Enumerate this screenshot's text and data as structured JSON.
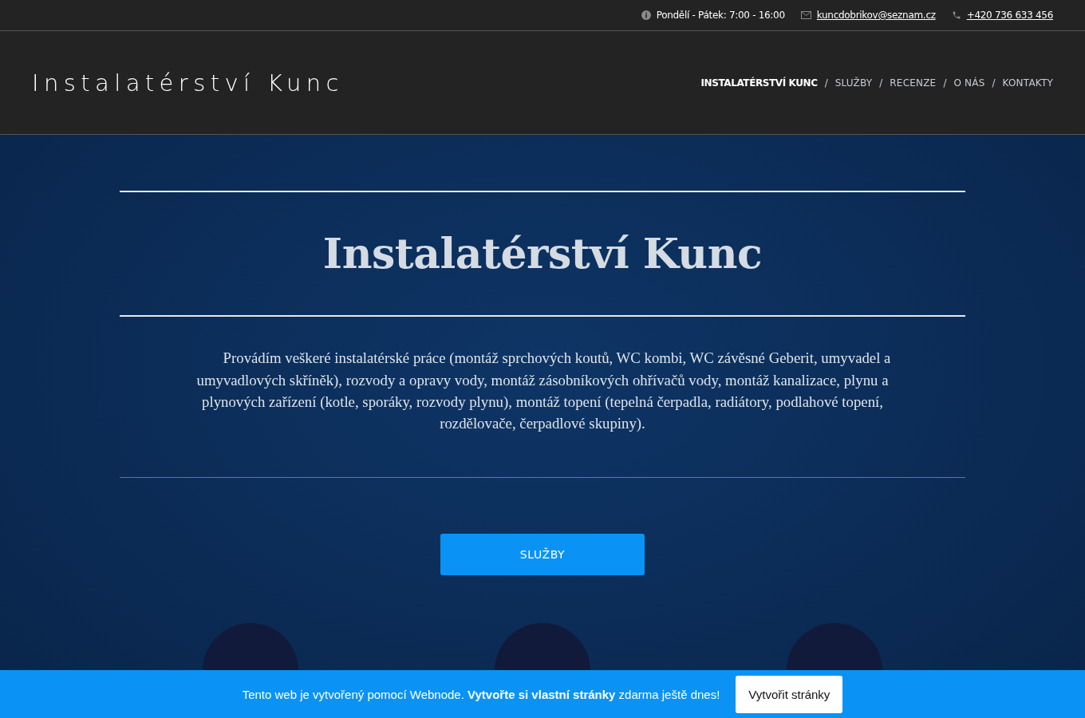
{
  "top_bar": {
    "hours": "Pondělí - Pátek: 7:00 - 16:00",
    "email": "kuncdobrikov@seznam.cz",
    "phone": "+420 736 633 456"
  },
  "header": {
    "logo": "Instalatérství Kunc",
    "nav_separator": "/",
    "nav": [
      {
        "label": "INSTALATÉRSTVÍ KUNC",
        "selected": true
      },
      {
        "label": "SLUŽBY",
        "selected": false
      },
      {
        "label": "RECENZE",
        "selected": false
      },
      {
        "label": "O NÁS",
        "selected": false
      },
      {
        "label": "KONTAKTY",
        "selected": false
      }
    ]
  },
  "hero": {
    "title": "Instalatérství Kunc",
    "text": "Provádím veškeré instalatérské práce (montáž sprchových koutů, WC kombi, WC závěsné Geberit, umyvadel a umyvadlových skříněk), rozvody a opravy vody, montáž zásobníkových ohřívačů vody, montáž kanalizace, plynu a plynových zařízení (kotle, sporáky, rozvody plynu), montáž topení (tepelná čerpadla, radiátory, podlahové topení, rozdělovače, čerpadlové skupiny).",
    "button": "SLUŽBY"
  },
  "banner": {
    "text": "Tento web je vytvořený pomocí Webnode. **Vytvořte si vlastní stránky** zdarma ještě dnes!",
    "button": "Vytvořit stránky"
  }
}
